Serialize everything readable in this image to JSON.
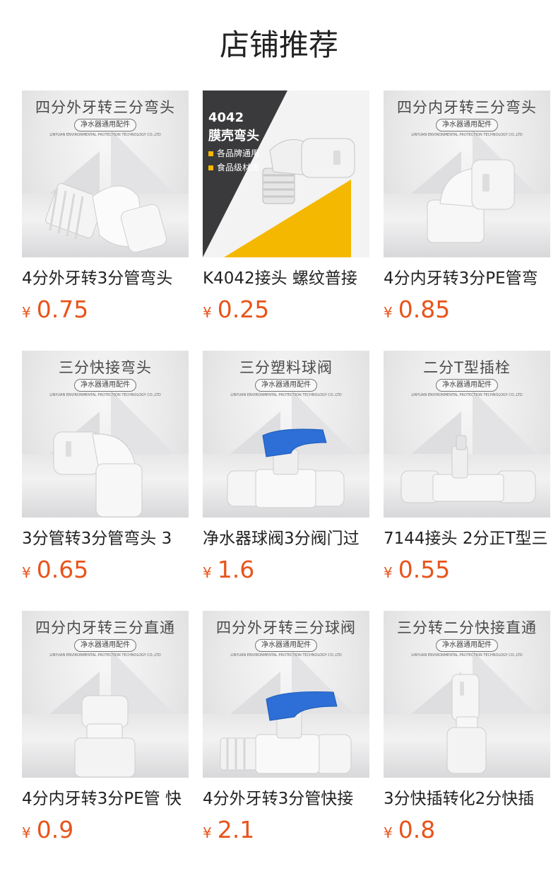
{
  "header": {
    "title": "店铺推荐"
  },
  "colors": {
    "price": "#e8541b",
    "accent_yellow": "#f5b800",
    "part_blue": "#2d6fd6"
  },
  "common_tag": "净水器通用配件",
  "common_sub": "LINYUAN ENVIRONMENTAL PROTECTION TECHNOLOGY CO.,LTD",
  "products": [
    {
      "caption": "四分外牙转三分弯头",
      "name": "4分外牙转3分管弯头",
      "currency": "¥",
      "price": "0.75"
    },
    {
      "promo_lines": [
        "4042",
        "膜壳弯头",
        "各品牌通用",
        "食品级材质"
      ],
      "name": "K4042接头 螺纹普接",
      "currency": "¥",
      "price": "0.25"
    },
    {
      "caption": "四分内牙转三分弯头",
      "name": "4分内牙转3分PE管弯",
      "currency": "¥",
      "price": "0.85"
    },
    {
      "caption": "三分快接弯头",
      "name": "3分管转3分管弯头 3",
      "currency": "¥",
      "price": "0.65"
    },
    {
      "caption": "三分塑料球阀",
      "name": "净水器球阀3分阀门过",
      "currency": "¥",
      "price": "1.6"
    },
    {
      "caption": "二分T型插栓",
      "name": "7144接头 2分正T型三",
      "currency": "¥",
      "price": "0.55"
    },
    {
      "caption": "四分内牙转三分直通",
      "name": "4分内牙转3分PE管 快",
      "currency": "¥",
      "price": "0.9"
    },
    {
      "caption": "四分外牙转三分球阀",
      "name": "4分外牙转3分管快接",
      "currency": "¥",
      "price": "2.1"
    },
    {
      "caption": "三分转二分快接直通",
      "name": "3分快插转化2分快插",
      "currency": "¥",
      "price": "0.8"
    }
  ]
}
